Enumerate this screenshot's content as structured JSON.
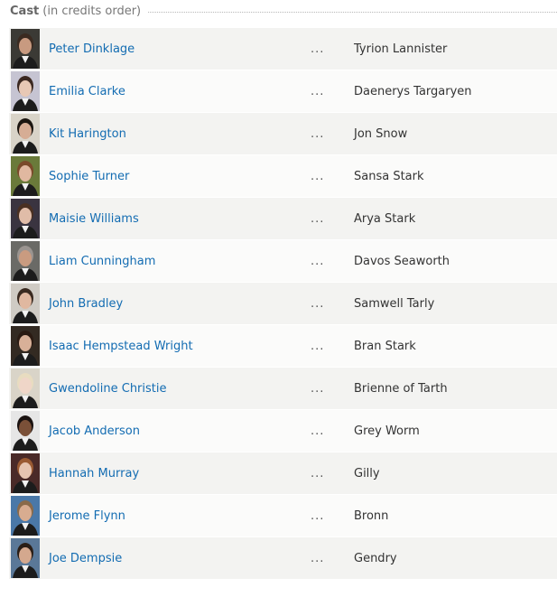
{
  "header": {
    "title": "Cast",
    "subtitle": "(in credits order)"
  },
  "cast": [
    {
      "name": "Peter Dinklage",
      "character": "Tyrion Lannister",
      "bg": "#3b3a35",
      "skin": "#c89a80",
      "hair": "#3a2a20"
    },
    {
      "name": "Emilia Clarke",
      "character": "Daenerys Targaryen",
      "bg": "#c6c4d2",
      "skin": "#e7c8b5",
      "hair": "#3b2820"
    },
    {
      "name": "Kit Harington",
      "character": "Jon Snow",
      "bg": "#d8d3c8",
      "skin": "#d6ad95",
      "hair": "#1b1510"
    },
    {
      "name": "Sophie Turner",
      "character": "Sansa Stark",
      "bg": "#6a7a3a",
      "skin": "#e0b8a0",
      "hair": "#7a4a2a"
    },
    {
      "name": "Maisie Williams",
      "character": "Arya Stark",
      "bg": "#3a3440",
      "skin": "#e0bca8",
      "hair": "#4a3022"
    },
    {
      "name": "Liam Cunningham",
      "character": "Davos Seaworth",
      "bg": "#6a6a66",
      "skin": "#c99b80",
      "hair": "#9a9490"
    },
    {
      "name": "John Bradley",
      "character": "Samwell Tarly",
      "bg": "#cfcbc4",
      "skin": "#e0b8a0",
      "hair": "#3a2a20"
    },
    {
      "name": "Isaac Hempstead Wright",
      "character": "Bran Stark",
      "bg": "#332a22",
      "skin": "#d8b098",
      "hair": "#2a1a12"
    },
    {
      "name": "Gwendoline Christie",
      "character": "Brienne of Tarth",
      "bg": "#d9d4c8",
      "skin": "#efd6c8",
      "hair": "#e8dcc0"
    },
    {
      "name": "Jacob Anderson",
      "character": "Grey Worm",
      "bg": "#e6e6e6",
      "skin": "#7a5038",
      "hair": "#1a1210"
    },
    {
      "name": "Hannah Murray",
      "character": "Gilly",
      "bg": "#4a2a28",
      "skin": "#e6c4b0",
      "hair": "#9a5a32"
    },
    {
      "name": "Jerome Flynn",
      "character": "Bronn",
      "bg": "#4a78a8",
      "skin": "#d8ac90",
      "hair": "#8a6a4a"
    },
    {
      "name": "Joe Dempsie",
      "character": "Gendry",
      "bg": "#5a7898",
      "skin": "#d4a88e",
      "hair": "#2a1e16"
    }
  ],
  "separator": "..."
}
